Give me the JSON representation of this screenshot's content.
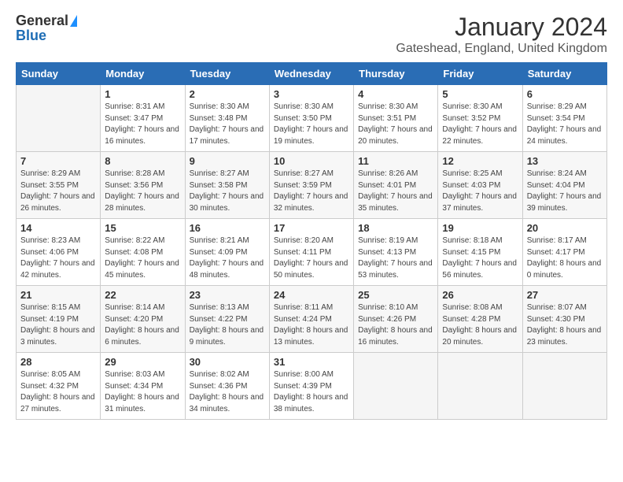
{
  "logo": {
    "general": "General",
    "blue": "Blue"
  },
  "title": "January 2024",
  "location": "Gateshead, England, United Kingdom",
  "headers": [
    "Sunday",
    "Monday",
    "Tuesday",
    "Wednesday",
    "Thursday",
    "Friday",
    "Saturday"
  ],
  "weeks": [
    [
      {
        "day": "",
        "sunrise": "",
        "sunset": "",
        "daylight": "",
        "empty": true
      },
      {
        "day": "1",
        "sunrise": "Sunrise: 8:31 AM",
        "sunset": "Sunset: 3:47 PM",
        "daylight": "Daylight: 7 hours and 16 minutes."
      },
      {
        "day": "2",
        "sunrise": "Sunrise: 8:30 AM",
        "sunset": "Sunset: 3:48 PM",
        "daylight": "Daylight: 7 hours and 17 minutes."
      },
      {
        "day": "3",
        "sunrise": "Sunrise: 8:30 AM",
        "sunset": "Sunset: 3:50 PM",
        "daylight": "Daylight: 7 hours and 19 minutes."
      },
      {
        "day": "4",
        "sunrise": "Sunrise: 8:30 AM",
        "sunset": "Sunset: 3:51 PM",
        "daylight": "Daylight: 7 hours and 20 minutes."
      },
      {
        "day": "5",
        "sunrise": "Sunrise: 8:30 AM",
        "sunset": "Sunset: 3:52 PM",
        "daylight": "Daylight: 7 hours and 22 minutes."
      },
      {
        "day": "6",
        "sunrise": "Sunrise: 8:29 AM",
        "sunset": "Sunset: 3:54 PM",
        "daylight": "Daylight: 7 hours and 24 minutes."
      }
    ],
    [
      {
        "day": "7",
        "sunrise": "Sunrise: 8:29 AM",
        "sunset": "Sunset: 3:55 PM",
        "daylight": "Daylight: 7 hours and 26 minutes."
      },
      {
        "day": "8",
        "sunrise": "Sunrise: 8:28 AM",
        "sunset": "Sunset: 3:56 PM",
        "daylight": "Daylight: 7 hours and 28 minutes."
      },
      {
        "day": "9",
        "sunrise": "Sunrise: 8:27 AM",
        "sunset": "Sunset: 3:58 PM",
        "daylight": "Daylight: 7 hours and 30 minutes."
      },
      {
        "day": "10",
        "sunrise": "Sunrise: 8:27 AM",
        "sunset": "Sunset: 3:59 PM",
        "daylight": "Daylight: 7 hours and 32 minutes."
      },
      {
        "day": "11",
        "sunrise": "Sunrise: 8:26 AM",
        "sunset": "Sunset: 4:01 PM",
        "daylight": "Daylight: 7 hours and 35 minutes."
      },
      {
        "day": "12",
        "sunrise": "Sunrise: 8:25 AM",
        "sunset": "Sunset: 4:03 PM",
        "daylight": "Daylight: 7 hours and 37 minutes."
      },
      {
        "day": "13",
        "sunrise": "Sunrise: 8:24 AM",
        "sunset": "Sunset: 4:04 PM",
        "daylight": "Daylight: 7 hours and 39 minutes."
      }
    ],
    [
      {
        "day": "14",
        "sunrise": "Sunrise: 8:23 AM",
        "sunset": "Sunset: 4:06 PM",
        "daylight": "Daylight: 7 hours and 42 minutes."
      },
      {
        "day": "15",
        "sunrise": "Sunrise: 8:22 AM",
        "sunset": "Sunset: 4:08 PM",
        "daylight": "Daylight: 7 hours and 45 minutes."
      },
      {
        "day": "16",
        "sunrise": "Sunrise: 8:21 AM",
        "sunset": "Sunset: 4:09 PM",
        "daylight": "Daylight: 7 hours and 48 minutes."
      },
      {
        "day": "17",
        "sunrise": "Sunrise: 8:20 AM",
        "sunset": "Sunset: 4:11 PM",
        "daylight": "Daylight: 7 hours and 50 minutes."
      },
      {
        "day": "18",
        "sunrise": "Sunrise: 8:19 AM",
        "sunset": "Sunset: 4:13 PM",
        "daylight": "Daylight: 7 hours and 53 minutes."
      },
      {
        "day": "19",
        "sunrise": "Sunrise: 8:18 AM",
        "sunset": "Sunset: 4:15 PM",
        "daylight": "Daylight: 7 hours and 56 minutes."
      },
      {
        "day": "20",
        "sunrise": "Sunrise: 8:17 AM",
        "sunset": "Sunset: 4:17 PM",
        "daylight": "Daylight: 8 hours and 0 minutes."
      }
    ],
    [
      {
        "day": "21",
        "sunrise": "Sunrise: 8:15 AM",
        "sunset": "Sunset: 4:19 PM",
        "daylight": "Daylight: 8 hours and 3 minutes."
      },
      {
        "day": "22",
        "sunrise": "Sunrise: 8:14 AM",
        "sunset": "Sunset: 4:20 PM",
        "daylight": "Daylight: 8 hours and 6 minutes."
      },
      {
        "day": "23",
        "sunrise": "Sunrise: 8:13 AM",
        "sunset": "Sunset: 4:22 PM",
        "daylight": "Daylight: 8 hours and 9 minutes."
      },
      {
        "day": "24",
        "sunrise": "Sunrise: 8:11 AM",
        "sunset": "Sunset: 4:24 PM",
        "daylight": "Daylight: 8 hours and 13 minutes."
      },
      {
        "day": "25",
        "sunrise": "Sunrise: 8:10 AM",
        "sunset": "Sunset: 4:26 PM",
        "daylight": "Daylight: 8 hours and 16 minutes."
      },
      {
        "day": "26",
        "sunrise": "Sunrise: 8:08 AM",
        "sunset": "Sunset: 4:28 PM",
        "daylight": "Daylight: 8 hours and 20 minutes."
      },
      {
        "day": "27",
        "sunrise": "Sunrise: 8:07 AM",
        "sunset": "Sunset: 4:30 PM",
        "daylight": "Daylight: 8 hours and 23 minutes."
      }
    ],
    [
      {
        "day": "28",
        "sunrise": "Sunrise: 8:05 AM",
        "sunset": "Sunset: 4:32 PM",
        "daylight": "Daylight: 8 hours and 27 minutes."
      },
      {
        "day": "29",
        "sunrise": "Sunrise: 8:03 AM",
        "sunset": "Sunset: 4:34 PM",
        "daylight": "Daylight: 8 hours and 31 minutes."
      },
      {
        "day": "30",
        "sunrise": "Sunrise: 8:02 AM",
        "sunset": "Sunset: 4:36 PM",
        "daylight": "Daylight: 8 hours and 34 minutes."
      },
      {
        "day": "31",
        "sunrise": "Sunrise: 8:00 AM",
        "sunset": "Sunset: 4:39 PM",
        "daylight": "Daylight: 8 hours and 38 minutes."
      },
      {
        "day": "",
        "sunrise": "",
        "sunset": "",
        "daylight": "",
        "empty": true
      },
      {
        "day": "",
        "sunrise": "",
        "sunset": "",
        "daylight": "",
        "empty": true
      },
      {
        "day": "",
        "sunrise": "",
        "sunset": "",
        "daylight": "",
        "empty": true
      }
    ]
  ]
}
